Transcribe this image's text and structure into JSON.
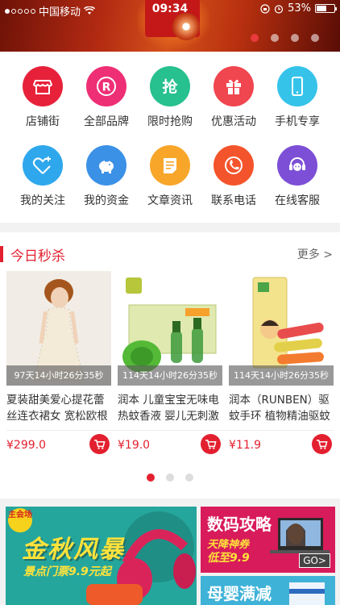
{
  "status_bar": {
    "carrier": "中国移动",
    "time": "09:34",
    "battery": "53%"
  },
  "banner": {
    "page_count": 4,
    "active_page": 0
  },
  "quick_nav": [
    {
      "label": "店铺街",
      "icon": "shop-icon",
      "color": "#e8213a"
    },
    {
      "label": "全部品牌",
      "icon": "brand-icon",
      "color": "#ee2f75"
    },
    {
      "label": "限时抢购",
      "icon": "flash-sale-icon",
      "color": "#27c08f"
    },
    {
      "label": "优惠活动",
      "icon": "gift-icon",
      "color": "#f0464f"
    },
    {
      "label": "手机专享",
      "icon": "phone-icon",
      "color": "#35c3ea"
    },
    {
      "label": "我的关注",
      "icon": "heart-plus-icon",
      "color": "#2fa7ec"
    },
    {
      "label": "我的资金",
      "icon": "piggy-bank-icon",
      "color": "#3b91e6"
    },
    {
      "label": "文章资讯",
      "icon": "article-icon",
      "color": "#f7a62a"
    },
    {
      "label": "联系电话",
      "icon": "telephone-icon",
      "color": "#f4542b"
    },
    {
      "label": "在线客服",
      "icon": "customer-service-icon",
      "color": "#7c4fd6"
    }
  ],
  "flash_sale": {
    "title": "今日秒杀",
    "more_label": "更多 >",
    "products": [
      {
        "countdown": "97天14小时26分35秒",
        "name": "夏装甜美爱心提花蕾丝连衣裙女 宽松欧根",
        "price": "¥299.0"
      },
      {
        "countdown": "114天14小时26分35秒",
        "name": "润本 儿童宝宝无味电热蚊香液 婴儿无刺激",
        "price": "¥19.0"
      },
      {
        "countdown": "114天14小时26分35秒",
        "name": "润本（RUNBEN）驱蚊手环 植物精油驱蚊",
        "price": "¥11.9"
      }
    ],
    "page_count": 3,
    "active_page": 0
  },
  "promos": {
    "tile_a": {
      "tag": "主会场",
      "headline": "金秋风暴",
      "sub": "景点门票9.9元起"
    },
    "tile_b": {
      "headline": "数码攻略",
      "line1": "天降神券",
      "line2": "低至9.9",
      "go": "GO>"
    },
    "tile_c": {
      "headline": "母婴满减"
    }
  },
  "colors": {
    "accent": "#e3202f"
  }
}
